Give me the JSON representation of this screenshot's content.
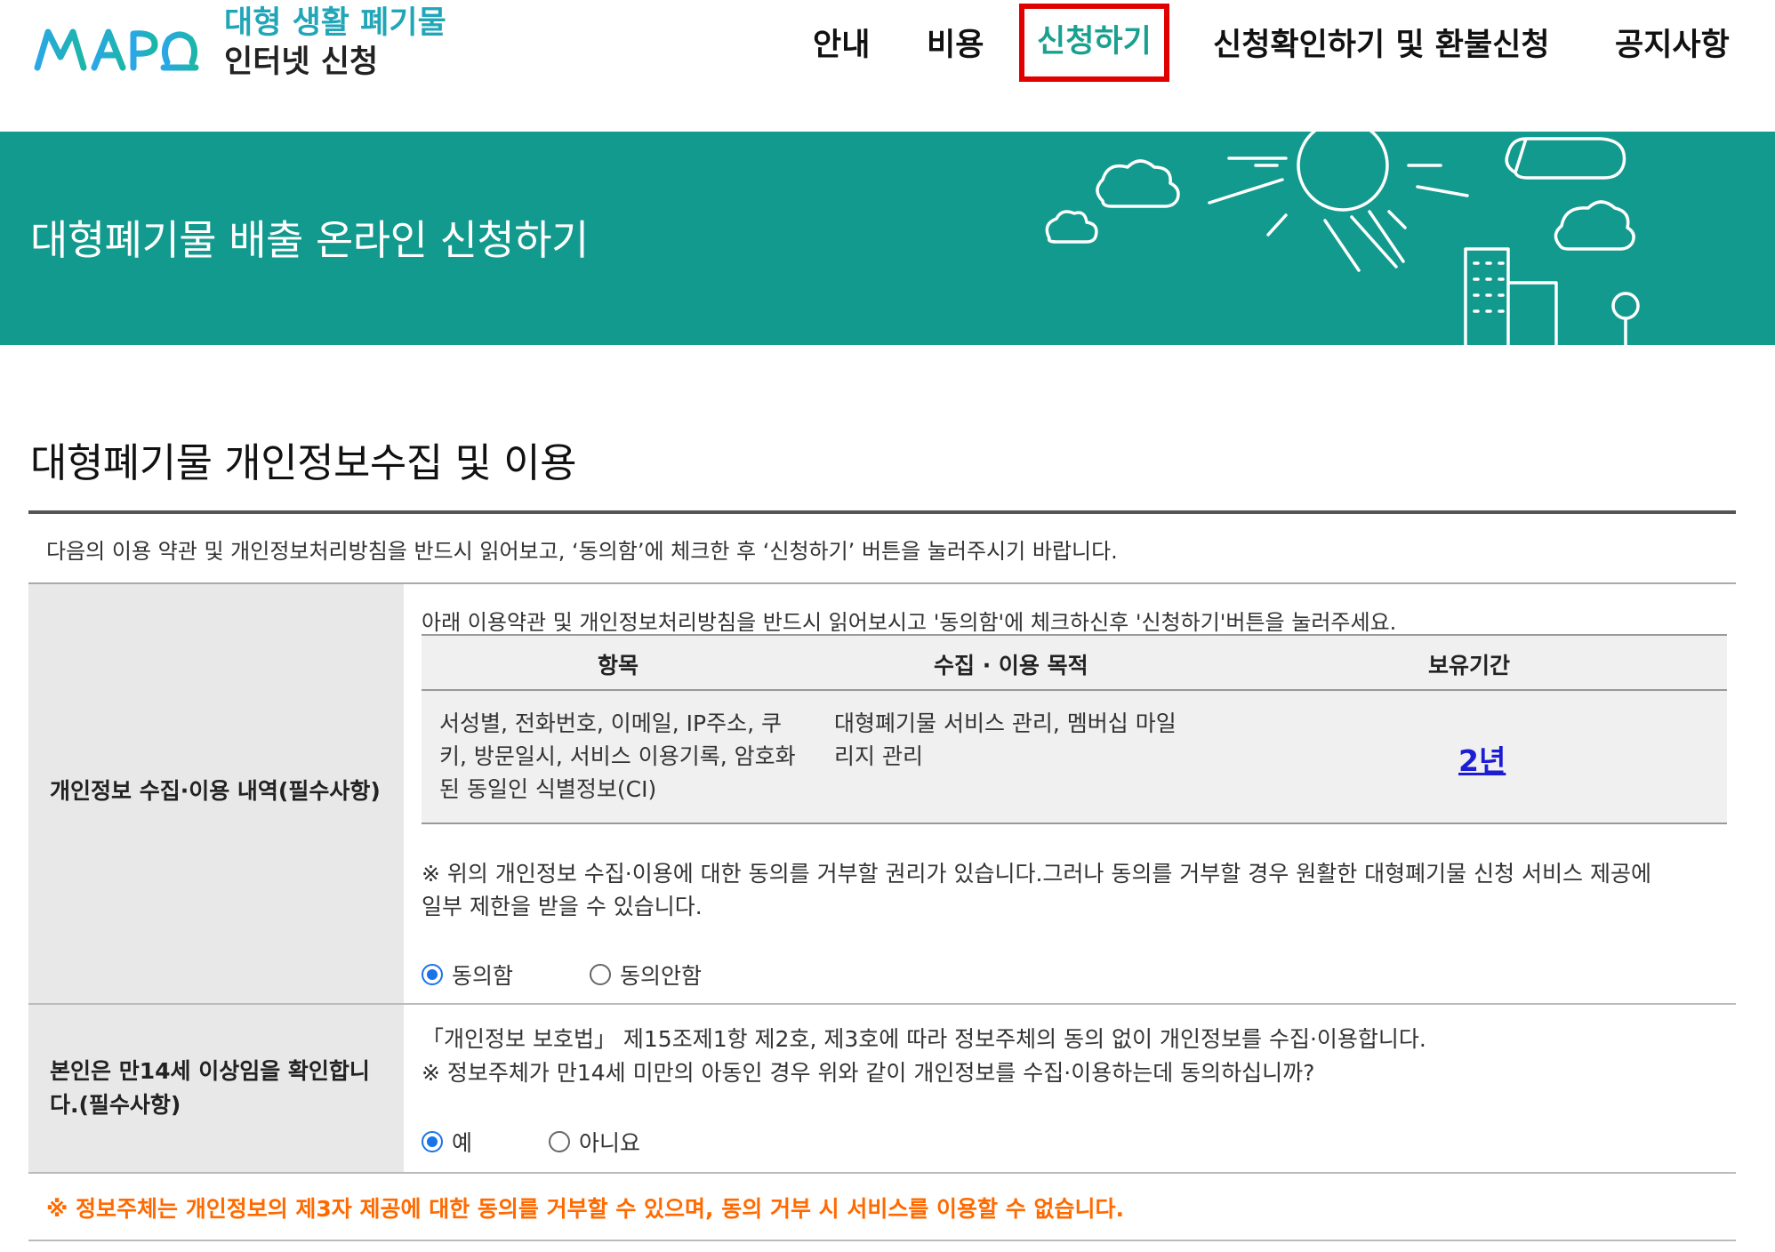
{
  "header": {
    "logo_text": "MAPO",
    "site_title_line1": "대형 생활 폐기물",
    "site_title_line2": "인터넷 신청",
    "nav": [
      {
        "label": "안내"
      },
      {
        "label": "비용"
      },
      {
        "label": "신청하기",
        "active": true
      },
      {
        "label": "신청확인하기 및 환불신청"
      },
      {
        "label": "공지사항"
      }
    ]
  },
  "banner": {
    "title": "대형폐기물 배출 온라인 신청하기",
    "background_color": "#139a8e"
  },
  "section": {
    "title": "대형폐기물 개인정보수집 및 이용",
    "notice": "다음의 이용 약관 및 개인정보처리방침을 반드시 읽어보고, ‘동의함’에 체크한 후 ‘신청하기’ 버튼을 눌러주시기 바랍니다."
  },
  "consent_collection": {
    "label": "개인정보 수집·이용 내역(필수사항)",
    "intro": "아래 이용약관 및 개인정보처리방침을 반드시 읽어보시고 '동의함'에 체크하신후 '신청하기'버튼을 눌러주세요.",
    "table": {
      "headers": [
        "항목",
        "수집 · 이용 목적",
        "보유기간"
      ],
      "row": {
        "items_lines": [
          "서성별, 전화번호, 이메일, IP주소, 쿠",
          "키, 방문일시, 서비스 이용기록, 암호화",
          "된 동일인 식별정보(CI)"
        ],
        "purpose_lines": [
          "대형폐기물 서비스 관리, 멤버십 마일",
          "리지 관리"
        ],
        "period": "2년"
      }
    },
    "note_line1": "※ 위의 개인정보 수집·이용에 대한 동의를 거부할 권리가 있습니다.그러나 동의를 거부할 경우 원활한 대형폐기물 신청 서비스 제공에",
    "note_line2": "일부 제한을 받을 수 있습니다.",
    "options": [
      {
        "label": "동의함",
        "checked": true
      },
      {
        "label": "동의안함",
        "checked": false
      }
    ]
  },
  "age_confirm": {
    "label_line1": "본인은 만14세 이상임을 확인합니",
    "label_line2": "다.(필수사항)",
    "law_line1": "「개인정보 보호법」 제15조제1항 제2호, 제3호에 따라 정보주체의 동의 없이 개인정보를 수집·이용합니다.",
    "law_line2": "※ 정보주체가 만14세 미만의 아동인 경우 위와 같이 개인정보를 수집·이용하는데 동의하십니까?",
    "options": [
      {
        "label": "예",
        "checked": true
      },
      {
        "label": "아니요",
        "checked": false
      }
    ]
  },
  "warning": "※ 정보주체는 개인정보의 제3자 제공에 대한 동의를 거부할 수 있으며, 동의 거부 시 서비스를 이용할 수 없습니다.",
  "colors": {
    "accent_teal": "#1aa08f",
    "logo_blue": "#21a6b8",
    "active_outline": "#e00000",
    "warning_orange": "#ff6a00",
    "link_blue": "#1d1dd6",
    "radio_blue": "#1a73e8"
  }
}
